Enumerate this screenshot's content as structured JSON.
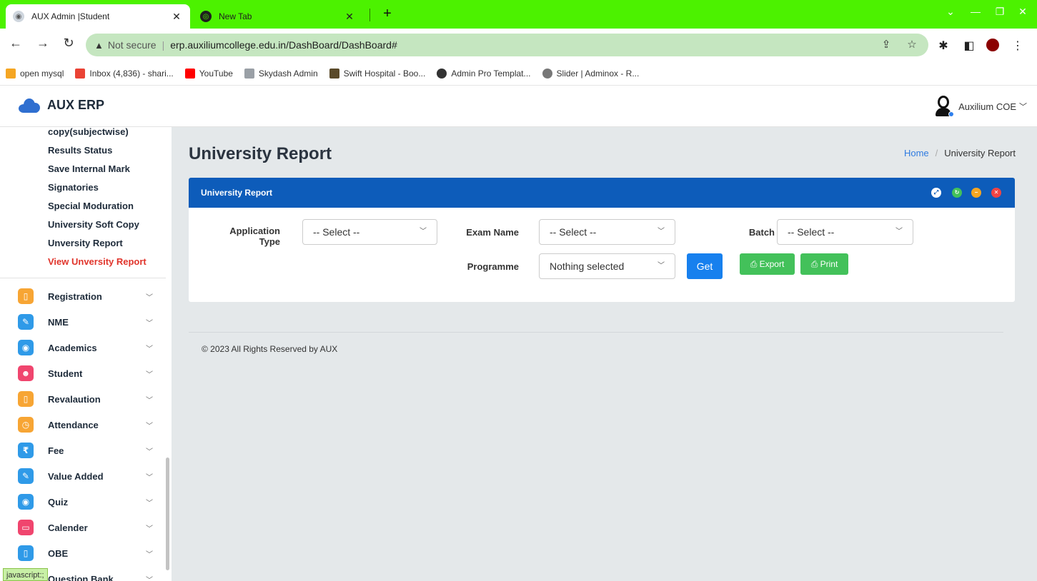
{
  "browser": {
    "tabs": [
      {
        "title": "AUX Admin |Student",
        "close": "✕"
      },
      {
        "title": "New Tab",
        "close": "✕"
      }
    ],
    "newtab": "+",
    "address": {
      "warning": "Not secure",
      "url": "erp.auxiliumcollege.edu.in/DashBoard/DashBoard#"
    },
    "bookmarks": [
      {
        "label": "open mysql",
        "color": "#f5a623"
      },
      {
        "label": "Inbox (4,836) - shari...",
        "color": "#ea4335"
      },
      {
        "label": "YouTube",
        "color": "#ff0000"
      },
      {
        "label": "Skydash Admin",
        "color": "#9aa0a6"
      },
      {
        "label": "Swift Hospital - Boo...",
        "color": "#5a4a2a"
      },
      {
        "label": "Admin Pro Templat...",
        "color": "#333333"
      },
      {
        "label": "Slider | Adminox - R...",
        "color": "#777777"
      }
    ]
  },
  "app": {
    "brand": "AUX ERP",
    "user": "Auxilium COE",
    "user_chevron": "﹀"
  },
  "sidebar": {
    "subitems": [
      {
        "label": "copy(subjectwise)"
      },
      {
        "label": "Results Status"
      },
      {
        "label": "Save Internal Mark"
      },
      {
        "label": "Signatories"
      },
      {
        "label": "Special Moduration"
      },
      {
        "label": "University Soft Copy"
      },
      {
        "label": "Unversity Report"
      },
      {
        "label": "View Unversity Report"
      }
    ],
    "menu": [
      {
        "label": "Registration",
        "color": "#f7a534",
        "glyph": "▯"
      },
      {
        "label": "NME",
        "color": "#2f9ae8",
        "glyph": "✎"
      },
      {
        "label": "Academics",
        "color": "#2f9ae8",
        "glyph": "◉"
      },
      {
        "label": "Student",
        "color": "#f0456e",
        "glyph": "☻"
      },
      {
        "label": "Revalaution",
        "color": "#f7a534",
        "glyph": "▯"
      },
      {
        "label": "Attendance",
        "color": "#f7a534",
        "glyph": "◷"
      },
      {
        "label": "Fee",
        "color": "#2f9ae8",
        "glyph": "₹"
      },
      {
        "label": "Value Added",
        "color": "#2f9ae8",
        "glyph": "✎"
      },
      {
        "label": "Quiz",
        "color": "#2f9ae8",
        "glyph": "◉"
      },
      {
        "label": "Calender",
        "color": "#f0456e",
        "glyph": "▭"
      },
      {
        "label": "OBE",
        "color": "#2f9ae8",
        "glyph": "▯"
      },
      {
        "label": "Question Bank",
        "color": "#2f9ae8",
        "glyph": "?"
      }
    ],
    "status_text": "javascript:;"
  },
  "main": {
    "title": "University Report",
    "breadcrumb": {
      "home": "Home",
      "sep": "/",
      "current": "University Report"
    },
    "card": {
      "title": "University Report",
      "fields": {
        "application_type": {
          "label": "Application Type",
          "value": "-- Select --"
        },
        "exam_name": {
          "label": "Exam Name",
          "value": "-- Select --"
        },
        "batch": {
          "label": "Batch",
          "value": "-- Select --"
        },
        "programme": {
          "label": "Programme",
          "value": "Nothing selected"
        }
      },
      "buttons": {
        "get": "Get",
        "export": "⎙ Export",
        "print": "⎙ Print"
      }
    },
    "footer": "© 2023 All Rights Reserved by AUX"
  },
  "colors": {
    "chrome": "#4cf200",
    "card_header": "#0d5cba",
    "get": "#1780ee",
    "green": "#43c15a",
    "active_link": "#e0342b"
  }
}
